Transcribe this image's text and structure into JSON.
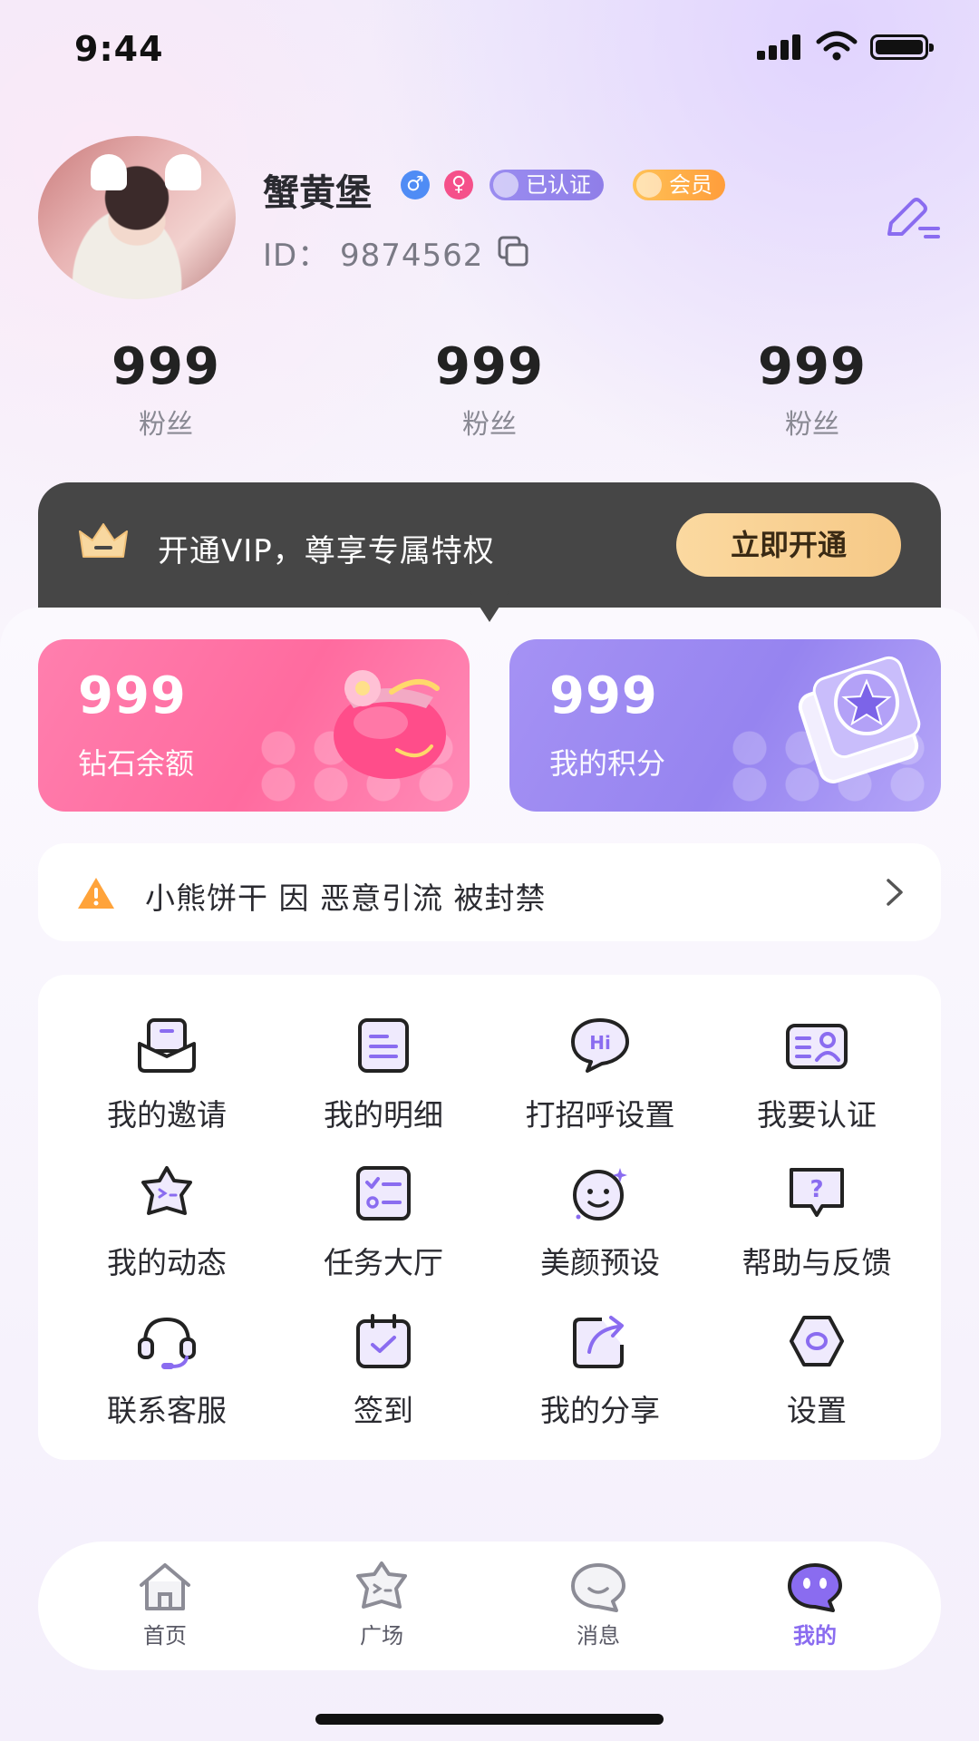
{
  "status_bar": {
    "time": "9:44"
  },
  "profile": {
    "name": "蟹黄堡",
    "gender_male_symbol": "♂",
    "gender_female_symbol": "♀",
    "badge_verified": "已认证",
    "badge_member": "会员",
    "id_text": "ID：  9874562"
  },
  "stats": [
    {
      "value": "999",
      "label": "粉丝"
    },
    {
      "value": "999",
      "label": "粉丝"
    },
    {
      "value": "999",
      "label": "粉丝"
    }
  ],
  "vip": {
    "text": "开通VIP，尊享专属特权",
    "button": "立即开通"
  },
  "wallet": {
    "diamond": {
      "value": "999",
      "label": "钻石余额"
    },
    "points": {
      "value": "999",
      "label": "我的积分"
    }
  },
  "notice": {
    "text": "小熊饼干 因 恶意引流 被封禁"
  },
  "menu": [
    {
      "label": "我的邀请",
      "icon": "invite-icon"
    },
    {
      "label": "我的明细",
      "icon": "details-icon"
    },
    {
      "label": "打招呼设置",
      "icon": "greeting-icon"
    },
    {
      "label": "我要认证",
      "icon": "verify-icon"
    },
    {
      "label": "我的动态",
      "icon": "moments-icon"
    },
    {
      "label": "任务大厅",
      "icon": "tasks-icon"
    },
    {
      "label": "美颜预设",
      "icon": "beauty-icon"
    },
    {
      "label": "帮助与反馈",
      "icon": "help-icon"
    },
    {
      "label": "联系客服",
      "icon": "support-icon"
    },
    {
      "label": "签到",
      "icon": "checkin-icon"
    },
    {
      "label": "我的分享",
      "icon": "share-icon"
    },
    {
      "label": "设置",
      "icon": "settings-icon"
    }
  ],
  "nav": [
    {
      "label": "首页",
      "icon": "home-icon"
    },
    {
      "label": "广场",
      "icon": "square-icon"
    },
    {
      "label": "消息",
      "icon": "message-icon"
    },
    {
      "label": "我的",
      "icon": "profile-icon",
      "active": true
    }
  ],
  "colors": {
    "accent": "#8a6cf0",
    "vip_dark": "#464646",
    "vip_gold": "#f6c987",
    "diamond_pink": "#ff6b9f",
    "points_purple": "#9684f0"
  }
}
